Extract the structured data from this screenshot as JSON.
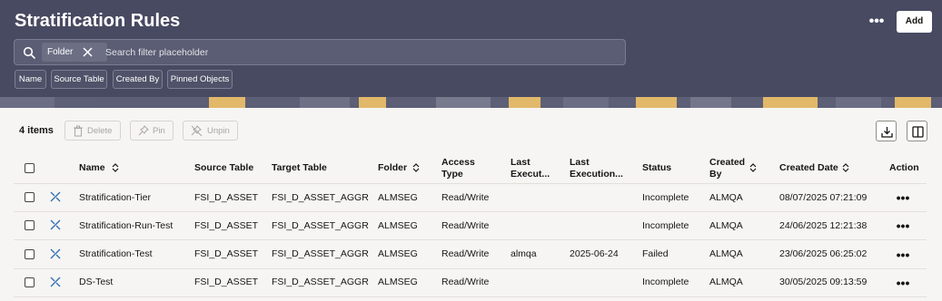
{
  "header": {
    "title": "Stratification Rules",
    "add_label": "Add",
    "more_label": "•••",
    "search": {
      "chip_label": "Folder",
      "placeholder": "Search filter placeholder"
    },
    "filters": [
      "Name",
      "Source Table",
      "Created By",
      "Pinned Objects"
    ]
  },
  "toolbar": {
    "count": "4 items",
    "delete_label": "Delete",
    "pin_label": "Pin",
    "unpin_label": "Unpin"
  },
  "table": {
    "columns": {
      "name": "Name",
      "source": "Source Table",
      "target": "Target Table",
      "folder": "Folder",
      "access_1": "Access",
      "access_2": "Type",
      "last_exec_by": "Last",
      "last_exec_by_2": "Execut...",
      "last_exec_on": "Last",
      "last_exec_on_2": "Execution...",
      "status": "Status",
      "created_by_1": "Created",
      "created_by_2": "By",
      "created_date": "Created Date",
      "action": "Action"
    },
    "rows": [
      {
        "name": "Stratification-Tier",
        "source": "FSI_D_ASSET",
        "target": "FSI_D_ASSET_AGGR",
        "folder": "ALMSEG",
        "access": "Read/Write",
        "exec_by": "",
        "exec_on": "",
        "status": "Incomplete",
        "created_by": "ALMQA",
        "created_date": "08/07/2025 07:21:09"
      },
      {
        "name": "Stratification-Run-Test",
        "source": "FSI_D_ASSET",
        "target": "FSI_D_ASSET_AGGR",
        "folder": "ALMSEG",
        "access": "Read/Write",
        "exec_by": "",
        "exec_on": "",
        "status": "Incomplete",
        "created_by": "ALMQA",
        "created_date": "24/06/2025 12:21:38"
      },
      {
        "name": "Stratification-Test",
        "source": "FSI_D_ASSET",
        "target": "FSI_D_ASSET_AGGR",
        "folder": "ALMSEG",
        "access": "Read/Write",
        "exec_by": "almqa",
        "exec_on": "2025-06-24",
        "status": "Failed",
        "created_by": "ALMQA",
        "created_date": "23/06/2025 06:25:02"
      },
      {
        "name": "DS-Test",
        "source": "FSI_D_ASSET",
        "target": "FSI_D_ASSET_AGGR",
        "folder": "ALMSEG",
        "access": "Read/Write",
        "exec_by": "",
        "exec_on": "",
        "status": "Incomplete",
        "created_by": "ALMQA",
        "created_date": "30/05/2025 09:13:59"
      }
    ]
  }
}
